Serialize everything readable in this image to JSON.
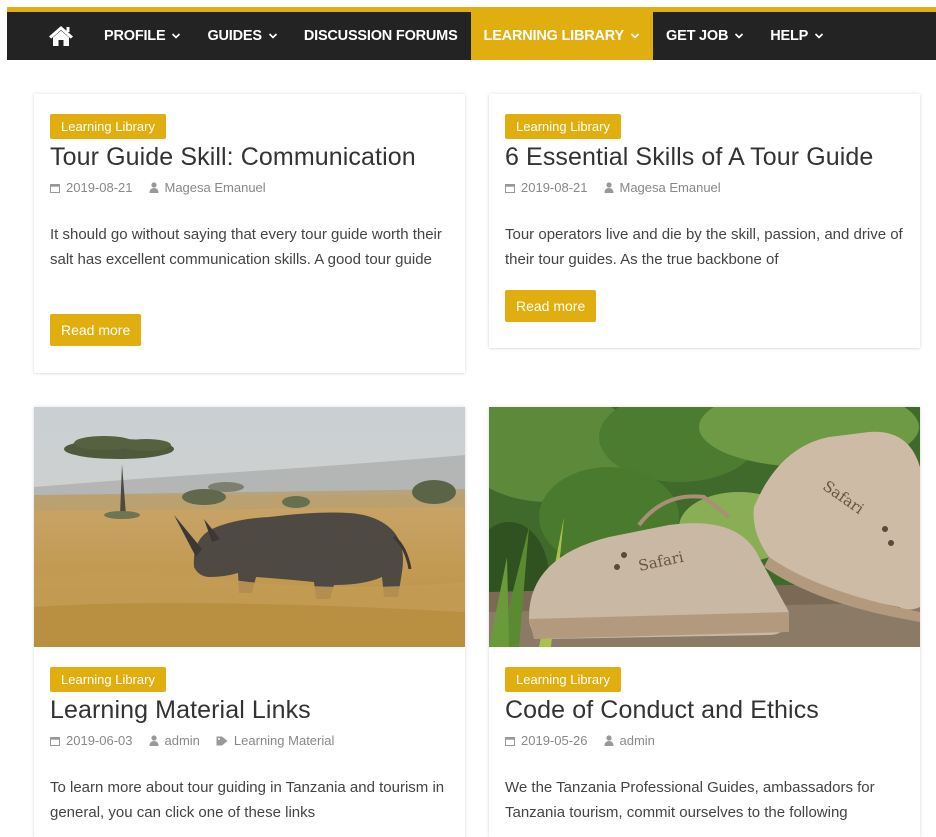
{
  "nav": {
    "home_icon": "home-icon",
    "items": [
      {
        "label": "PROFILE",
        "dropdown": true
      },
      {
        "label": "GUIDES",
        "dropdown": true
      },
      {
        "label": "DISCUSSION FORUMS",
        "dropdown": false
      },
      {
        "label": "LEARNING LIBRARY",
        "dropdown": true,
        "active": true
      },
      {
        "label": "GET JOB",
        "dropdown": true
      },
      {
        "label": "HELP",
        "dropdown": true
      }
    ]
  },
  "colors": {
    "accent": "#e0ae0e",
    "navbar": "#232323"
  },
  "posts": [
    {
      "category": "Learning Library",
      "title": "Tour Guide Skill: Communication",
      "date": "2019-08-21",
      "author": "Magesa Emanuel",
      "excerpt": "It should go without saying that every tour guide worth their salt has excellent communication skills. A good tour guide",
      "read_more": "Read more"
    },
    {
      "category": "Learning Library",
      "title": "6 Essential Skills of A Tour Guide",
      "date": "2019-08-21",
      "author": "Magesa Emanuel",
      "excerpt": "Tour operators live and die by the skill, passion, and drive of their tour guides. As the true backbone of",
      "read_more": "Read more"
    },
    {
      "image": "rhino-savanna-image",
      "category": "Learning Library",
      "title": "Learning Material Links",
      "date": "2019-06-03",
      "author": "admin",
      "tag": "Learning Material",
      "excerpt": "To learn more about tour guiding in Tanzania and tourism in general, you can click one of these links"
    },
    {
      "image": "safari-boots-image",
      "image_text": "Safari",
      "category": "Learning Library",
      "title": "Code of Conduct and Ethics",
      "date": "2019-05-26",
      "author": "admin",
      "excerpt": "We the Tanzania Professional Guides, ambassadors for Tanzania tourism, commit ourselves to the following"
    }
  ]
}
